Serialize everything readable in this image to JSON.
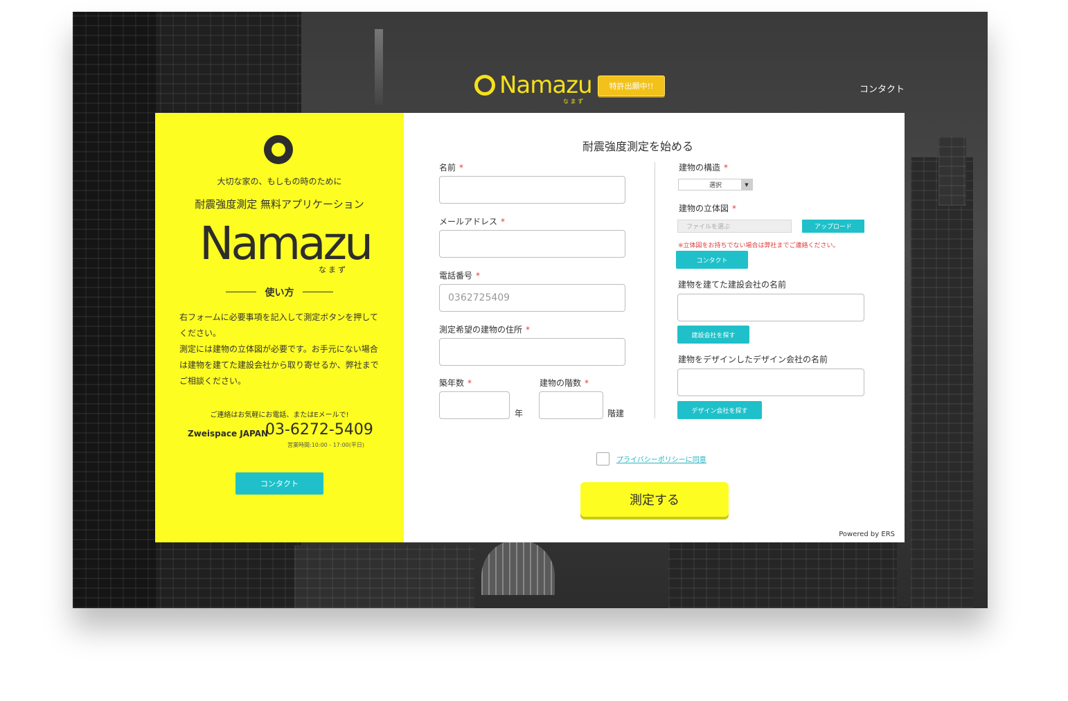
{
  "header": {
    "logo_word": "Namazu",
    "logo_sub": "な ま ず",
    "badge": "特許出願中!!",
    "contact_link": "コンタクト"
  },
  "left_panel": {
    "tagline_1": "大切な家の、もしもの時のために",
    "tagline_2": "耐震強度測定 無料アプリケーション",
    "logo_word": "Namazu",
    "logo_kana": "なまず",
    "howto_title": "使い方",
    "howto_text_1": "右フォームに必要事項を記入して測定ボタンを押してください。",
    "howto_text_2": "測定には建物の立体図が必要です。お手元にない場合は建物を建てた建設会社から取り寄せるか、弊社までご相談ください。",
    "contact_note": "ご連絡はお気軽にお電話、またはEメールで!",
    "company": "Zweispace JAPAN",
    "phone": "03-6272-5409",
    "hours": "営業時間:10:00 - 17:00(平日)",
    "contact_button": "コンタクト"
  },
  "form": {
    "title": "耐震強度測定を始める",
    "required_mark": "*",
    "name_label": "名前",
    "email_label": "メールアドレス",
    "phone_label": "電話番号",
    "phone_placeholder": "0362725409",
    "address_label": "測定希望の建物の住所",
    "age_label": "築年数",
    "age_unit": "年",
    "floors_label": "建物の階数",
    "floors_unit": "階建",
    "structure_label": "建物の構造",
    "structure_value": "選択",
    "drawing_label": "建物の立体図",
    "file_placeholder": "ファイルを選ぶ",
    "upload_button": "アップロード",
    "drawing_note": "※立体図をお持ちでない場合は弊社までご連絡ください。",
    "drawing_contact_button": "コンタクト",
    "builder_label": "建物を建てた建設会社の名前",
    "builder_button": "建設会社を探す",
    "designer_label": "建物をデザインしたデザイン会社の名前",
    "designer_button": "デザイン会社を探す",
    "privacy_link": "プライバシーポリシーに同意",
    "submit_button": "測定する",
    "powered_by": "Powered by ERS"
  },
  "colors": {
    "brand_yellow": "#fdfd22",
    "teal": "#1fc0c9",
    "badge_gold": "#f2c21a",
    "required_red": "#e03c3c"
  }
}
